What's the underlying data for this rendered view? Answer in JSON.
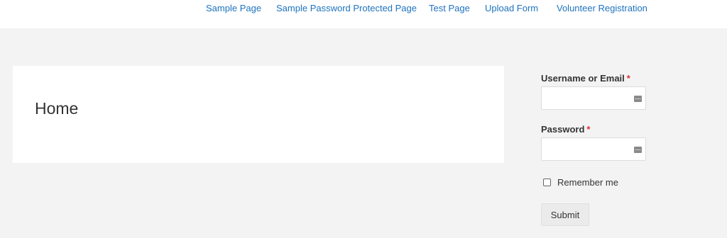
{
  "nav": {
    "items": [
      {
        "label": "Sample Page"
      },
      {
        "label": "Sample Password Protected Page"
      },
      {
        "label": "Test Page"
      },
      {
        "label": "Upload Form"
      },
      {
        "label": "Volunteer Registration"
      }
    ]
  },
  "content": {
    "title": "Home"
  },
  "login": {
    "username_label": "Username or Email",
    "password_label": "Password",
    "required_marker": "*",
    "username_value": "",
    "password_value": "",
    "remember_label": "Remember me",
    "remember_checked": false,
    "submit_label": "Submit"
  },
  "colors": {
    "link": "#1e73be",
    "required": "#dd3333",
    "page_background": "#f3f3f3"
  },
  "icons": {
    "field_icon": "password-manager-icon"
  }
}
